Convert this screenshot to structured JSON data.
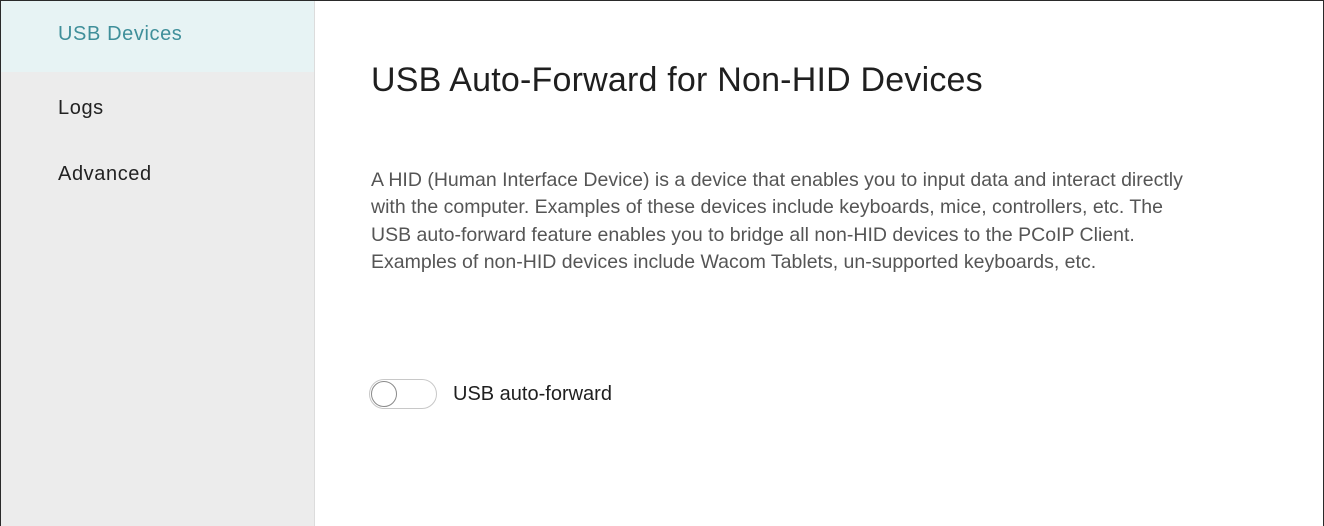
{
  "sidebar": {
    "items": [
      {
        "label": "USB Devices",
        "active": true
      },
      {
        "label": "Logs",
        "active": false
      },
      {
        "label": "Advanced",
        "active": false
      }
    ]
  },
  "main": {
    "title": "USB Auto-Forward for Non-HID Devices",
    "description": "A HID (Human Interface Device) is a device that enables you to input data and interact directly with the computer. Examples of these devices include keyboards, mice, controllers, etc. The USB auto-forward feature enables you to bridge all non-HID devices to the PCoIP Client. Examples of non-HID devices include Wacom Tablets, un-supported keyboards, etc.",
    "toggle": {
      "label": "USB auto-forward",
      "checked": false
    }
  },
  "colors": {
    "accent": "#3f8f9a",
    "sidebar_bg": "#ececec",
    "active_item_bg": "#e7f3f4"
  }
}
